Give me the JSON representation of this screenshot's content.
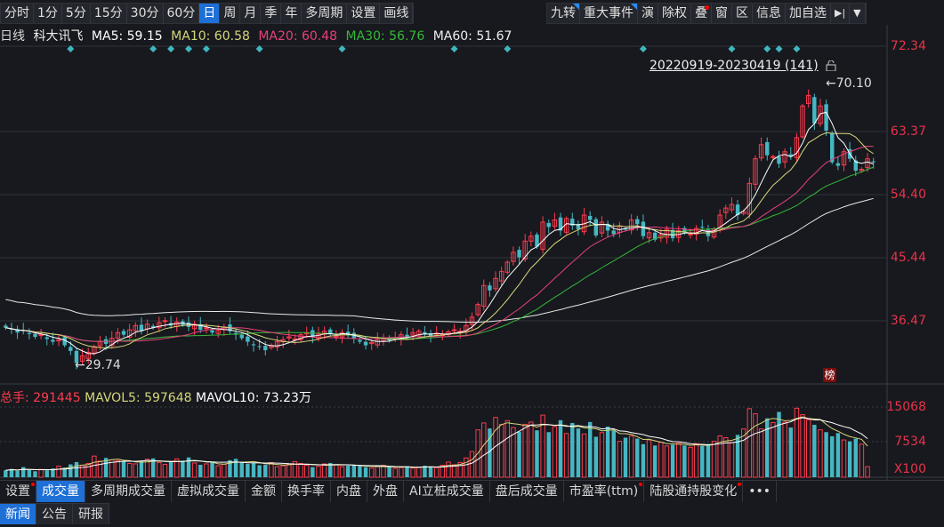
{
  "toolbar_left": [
    "分时",
    "1分",
    "5分",
    "15分",
    "30分",
    "60分",
    "日",
    "周",
    "月",
    "季",
    "年",
    "多周期",
    "设置",
    "画线"
  ],
  "toolbar_active": "日",
  "toolbar_right": [
    "九转",
    "重大事件",
    "演",
    "除权",
    "叠",
    "窗",
    "区",
    "信息",
    "加自选"
  ],
  "toolbar_icons": [
    "collapse-right-icon",
    "dropdown-arrow-icon"
  ],
  "info": {
    "period": "日线",
    "name": "科大讯飞",
    "ma5": "MA5: 59.15",
    "ma10": "MA10: 60.58",
    "ma20": "MA20: 60.48",
    "ma30": "MA30: 56.76",
    "ma60": "MA60: 51.67"
  },
  "price_axis": [
    "72.34",
    "63.37",
    "54.40",
    "45.44",
    "36.47"
  ],
  "range_label": "20220919-20230419 (141)",
  "high_label": "70.10",
  "low_label": "29.74",
  "badge": "榜",
  "vol_info": {
    "total": "总手: 291445",
    "mavol5": "MAVOL5: 597648",
    "mavol10": "MAVOL10: 73.23万"
  },
  "vol_axis": [
    "15068",
    "7534",
    "X100"
  ],
  "colors": {
    "up": "#ff3b4e",
    "down": "#46b7c3",
    "ma5": "#ffffff",
    "ma10": "#d6d67a",
    "ma20": "#e8407c",
    "ma30": "#36b83a",
    "ma60": "#e8e8e8"
  },
  "closes": [
    35.5,
    35.2,
    34.8,
    35.0,
    34.6,
    34.2,
    34.5,
    33.9,
    33.5,
    33.8,
    33.0,
    32.2,
    30.5,
    31.5,
    32.0,
    32.8,
    33.5,
    33.2,
    34.0,
    34.8,
    34.5,
    35.2,
    35.8,
    35.0,
    36.0,
    35.5,
    36.2,
    36.5,
    35.8,
    36.3,
    35.9,
    35.6,
    36.0,
    35.2,
    35.5,
    34.8,
    35.1,
    35.6,
    35.0,
    34.5,
    34.0,
    33.5,
    33.0,
    32.8,
    32.3,
    33.0,
    33.5,
    33.8,
    34.2,
    33.9,
    34.5,
    34.8,
    34.2,
    34.6,
    35.0,
    34.6,
    34.3,
    34.8,
    34.4,
    34.0,
    33.5,
    33.0,
    33.4,
    33.8,
    34.0,
    33.7,
    34.1,
    34.5,
    34.2,
    34.8,
    35.0,
    34.6,
    34.3,
    34.7,
    34.5,
    34.9,
    35.2,
    35.0,
    35.8,
    37.0,
    38.8,
    41.5,
    40.8,
    42.5,
    43.5,
    44.8,
    46.2,
    45.5,
    47.8,
    48.5,
    47.0,
    50.5,
    49.8,
    50.8,
    49.3,
    51.0,
    50.0,
    49.5,
    51.5,
    50.8,
    48.6,
    50.5,
    49.3,
    48.8,
    49.9,
    49.5,
    50.8,
    50.2,
    48.5,
    49.0,
    48.0,
    48.7,
    49.5,
    48.2,
    49.3,
    49.0,
    48.8,
    49.6,
    49.8,
    48.5,
    49.5,
    51.5,
    52.5,
    53.0,
    51.5,
    52.0,
    56.0,
    59.5,
    61.5,
    60.0,
    59.8,
    58.8,
    60.5,
    59.8,
    62.5,
    67.0,
    68.5,
    64.5,
    67.0,
    63.5,
    59.0,
    58.5,
    60.5,
    59.5,
    57.8,
    58.0,
    59.5,
    59.0
  ],
  "volumes": [
    1500,
    1800,
    1400,
    2200,
    1600,
    1300,
    1700,
    1500,
    1900,
    2400,
    2100,
    2800,
    3300,
    2600,
    3000,
    4600,
    3500,
    4200,
    3800,
    3600,
    3400,
    3000,
    2900,
    3500,
    3900,
    4100,
    3200,
    2800,
    3300,
    4000,
    3600,
    4300,
    3100,
    2700,
    2900,
    3400,
    2500,
    2800,
    3700,
    4000,
    3300,
    2900,
    3100,
    2600,
    2700,
    3200,
    2300,
    2500,
    2800,
    3400,
    3000,
    2600,
    2200,
    2400,
    2900,
    3100,
    2700,
    2300,
    2500,
    2700,
    2400,
    2200,
    2000,
    2300,
    2600,
    2200,
    1900,
    2100,
    2400,
    2000,
    2200,
    2500,
    2300,
    2100,
    2600,
    3300,
    2700,
    3200,
    4200,
    5600,
    10300,
    11800,
    10600,
    13000,
    11500,
    12300,
    10800,
    9900,
    11500,
    12000,
    10200,
    13500,
    9800,
    11000,
    12400,
    9500,
    11800,
    10600,
    9400,
    12000,
    8800,
    9700,
    11000,
    10200,
    7800,
    8600,
    9000,
    8400,
    7200,
    8100,
    6900,
    7600,
    6800,
    7100,
    7400,
    6900,
    6500,
    7300,
    6800,
    7200,
    7800,
    9000,
    8600,
    7500,
    9200,
    10500,
    14900,
    13800,
    10500,
    12800,
    11900,
    14200,
    12000,
    10800,
    15000,
    13600,
    12500,
    11400,
    10300,
    9800,
    8900,
    9600,
    8100,
    7800,
    8400,
    7200,
    2300
  ],
  "markers": [
    11,
    25,
    28,
    31,
    34,
    43,
    57,
    76,
    85,
    108,
    123,
    129,
    131,
    134
  ]
}
